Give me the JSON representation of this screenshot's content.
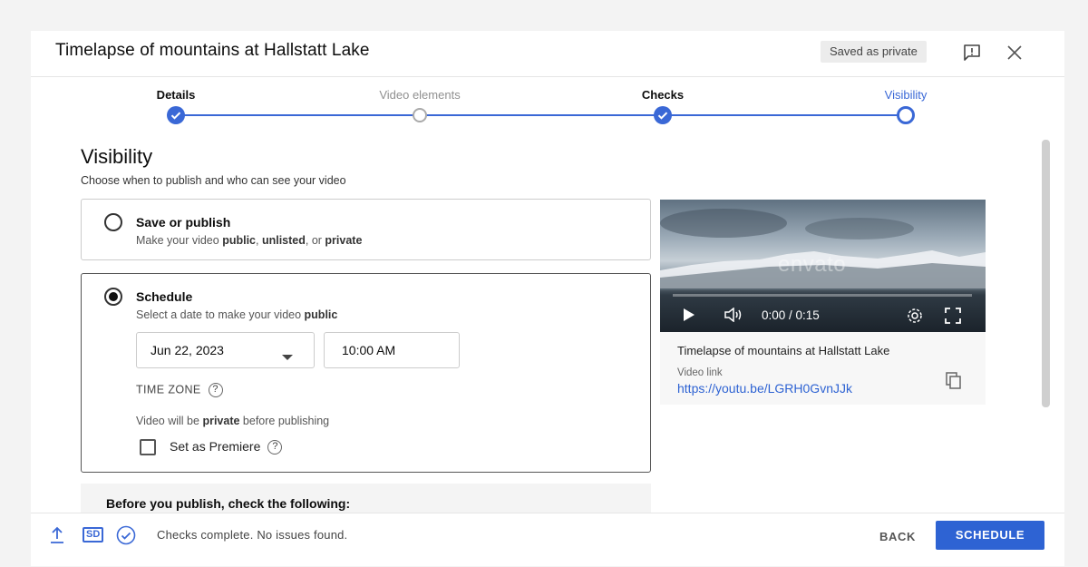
{
  "header": {
    "title": "Timelapse of mountains at Hallstatt Lake",
    "saved_badge": "Saved as private",
    "feedback_icon": "feedback-icon",
    "close_icon": "close-icon"
  },
  "stepper": {
    "steps": [
      {
        "label": "Details",
        "state": "done"
      },
      {
        "label": "Video elements",
        "state": "pending"
      },
      {
        "label": "Checks",
        "state": "done"
      },
      {
        "label": "Visibility",
        "state": "current"
      }
    ]
  },
  "visibility": {
    "title": "Visibility",
    "subtitle": "Choose when to publish and who can see your video",
    "save_or_publish": {
      "title": "Save or publish",
      "desc_prefix": "Make your video ",
      "desc_public": "public",
      "desc_sep1": ", ",
      "desc_unlisted": "unlisted",
      "desc_sep2": ", or ",
      "desc_private": "private",
      "selected": false
    },
    "schedule": {
      "title": "Schedule",
      "desc_prefix": "Select a date to make your video ",
      "desc_bold": "public",
      "selected": true,
      "date": "Jun 22, 2023",
      "time": "10:00 AM",
      "timezone_label": "TIME ZONE",
      "private_note_prefix": "Video will be ",
      "private_note_bold": "private",
      "private_note_suffix": " before publishing",
      "premiere_label": "Set as Premiere",
      "premiere_checked": false
    },
    "before_publish": "Before you publish, check the following:"
  },
  "preview": {
    "watermark": "envato",
    "time": "0:00 / 0:15",
    "progress": 0.0,
    "video_title": "Timelapse of mountains at Hallstatt Lake",
    "link_label": "Video link",
    "link": "https://youtu.be/LGRH0GvnJJk"
  },
  "footer": {
    "status": "Checks complete. No issues found.",
    "back_label": "BACK",
    "schedule_label": "SCHEDULE",
    "sd_label": "SD"
  },
  "colors": {
    "accent": "#2e63d3",
    "step_line": "#3a68d6"
  }
}
